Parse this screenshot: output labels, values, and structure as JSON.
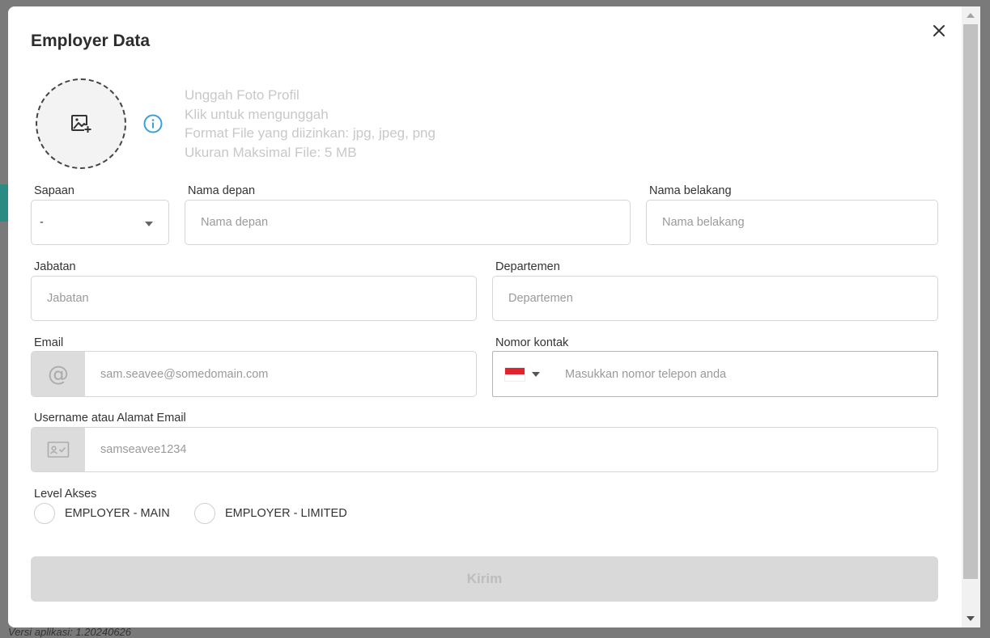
{
  "background": {
    "bottom_text": "Versi aplikasi: 1.20240626"
  },
  "modal": {
    "title": "Employer Data",
    "close_icon": "close-icon"
  },
  "profile_upload": {
    "icon": "image-add-icon",
    "info_icon": "info-icon",
    "lines": [
      "Unggah Foto Profil",
      "Klik untuk mengunggah",
      "Format File yang diizinkan: jpg, jpeg, png",
      "Ukuran Maksimal File: 5 MB"
    ]
  },
  "form": {
    "salutation": {
      "label": "Sapaan",
      "value": "-"
    },
    "first_name": {
      "label": "Nama depan",
      "placeholder": "Nama depan"
    },
    "last_name": {
      "label": "Nama belakang",
      "placeholder": "Nama belakang"
    },
    "position": {
      "label": "Jabatan",
      "placeholder": "Jabatan"
    },
    "department": {
      "label": "Departemen",
      "placeholder": "Departemen"
    },
    "email": {
      "label": "Email",
      "placeholder": "sam.seavee@somedomain.com",
      "icon": "at-icon"
    },
    "phone": {
      "label": "Nomor kontak",
      "placeholder": "Masukkan nomor telepon anda",
      "flag": "indonesia-flag-icon"
    },
    "username": {
      "label": "Username atau Alamat Email",
      "placeholder": "samseavee1234",
      "icon": "id-card-icon"
    },
    "access_level": {
      "label": "Level Akses",
      "options": [
        "EMPLOYER - MAIN",
        "EMPLOYER - LIMITED"
      ]
    },
    "submit_label": "Kirim"
  },
  "colors": {
    "info_icon": "#3aa0d8",
    "submit_bg": "#d9d9d9",
    "flag_red": "#e0242f"
  }
}
